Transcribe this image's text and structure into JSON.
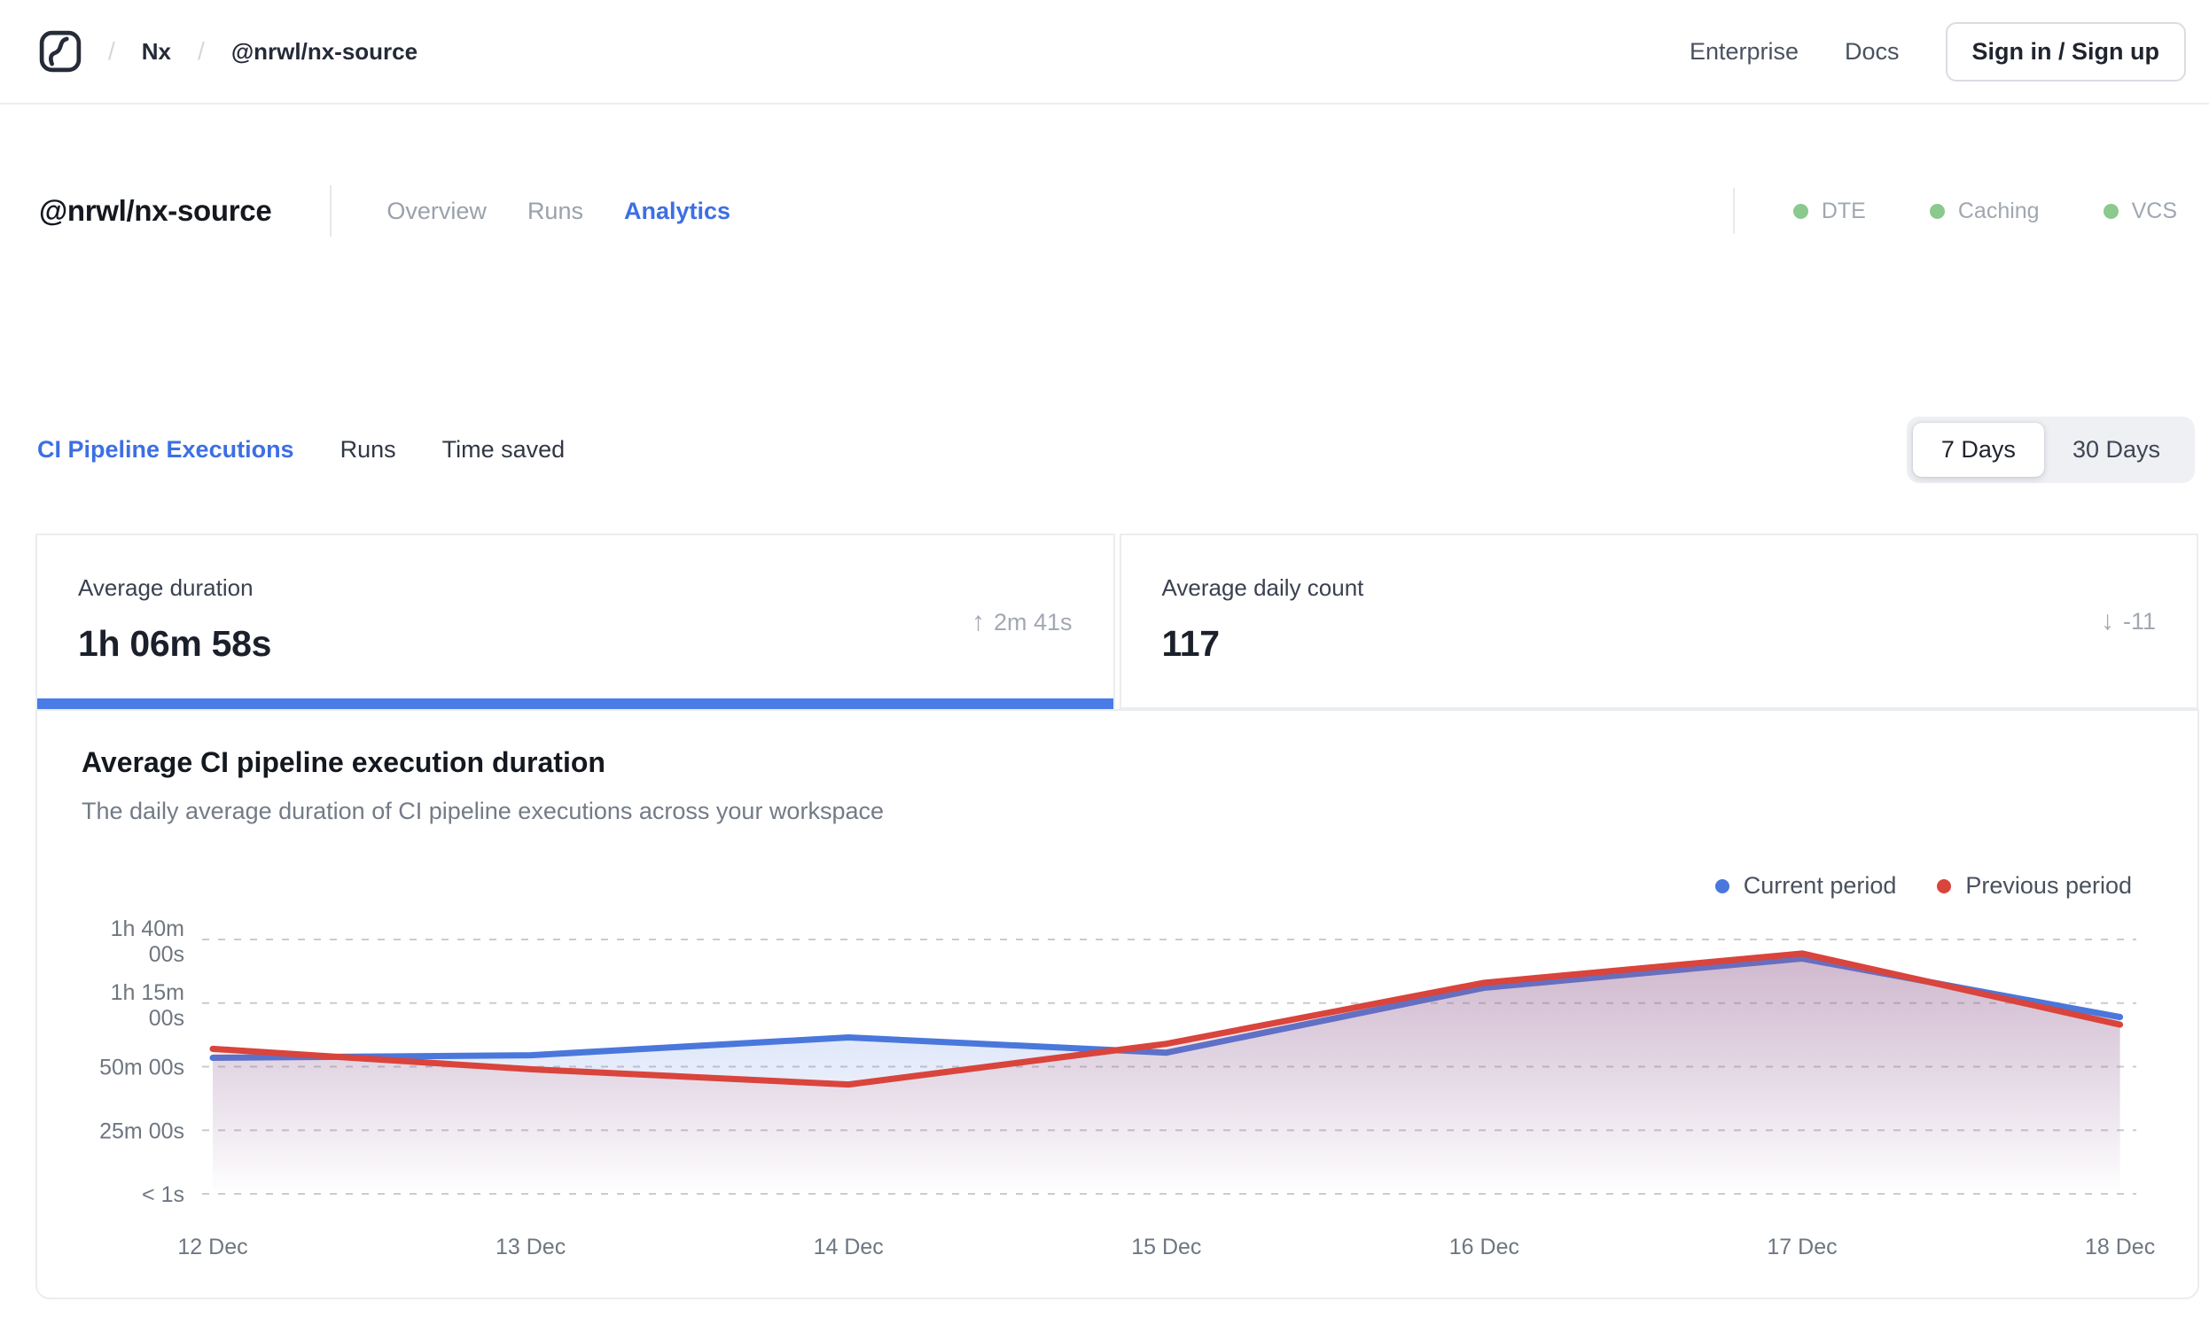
{
  "header": {
    "logo": "nx-cloud-logo",
    "breadcrumb": {
      "separator": "/",
      "items": [
        "Nx",
        "@nrwl/nx-source"
      ]
    },
    "links": [
      {
        "label": "Enterprise"
      },
      {
        "label": "Docs"
      }
    ],
    "signin_label": "Sign in / Sign up"
  },
  "titlebar": {
    "title": "@nrwl/nx-source",
    "tabs": [
      {
        "label": "Overview",
        "active": false
      },
      {
        "label": "Runs",
        "active": false
      },
      {
        "label": "Analytics",
        "active": true
      }
    ],
    "badges": [
      {
        "label": "DTE"
      },
      {
        "label": "Caching"
      },
      {
        "label": "VCS"
      }
    ],
    "badge_dot_color": "#8bc98f"
  },
  "subtabs": {
    "items": [
      {
        "label": "CI Pipeline Executions",
        "active": true
      },
      {
        "label": "Runs",
        "active": false
      },
      {
        "label": "Time saved",
        "active": false
      }
    ]
  },
  "range_toggle": {
    "options": [
      {
        "label": "7 Days",
        "active": true
      },
      {
        "label": "30 Days",
        "active": false
      }
    ]
  },
  "stats": [
    {
      "label": "Average duration",
      "value": "1h 06m 58s",
      "arrow_glyph": "↑",
      "delta": "2m 41s",
      "selected": true
    },
    {
      "label": "Average daily count",
      "value": "117",
      "arrow_glyph": "↓",
      "delta": "-11",
      "selected": false
    }
  ],
  "accent_colors": {
    "active_blue": "#3d6fe4",
    "selected_bar": "#4a7ce8"
  },
  "chart_data": {
    "type": "area",
    "title": "Average CI pipeline execution duration",
    "subtitle": "The daily average duration of CI pipeline executions across your workspace",
    "x": [
      "12 Dec",
      "13 Dec",
      "14 Dec",
      "15 Dec",
      "16 Dec",
      "17 Dec",
      "18 Dec"
    ],
    "y_ticks": [
      {
        "lines": [
          "1h 40m",
          "00s"
        ],
        "minutes": 100
      },
      {
        "lines": [
          "1h 15m",
          "00s"
        ],
        "minutes": 75
      },
      {
        "lines": [
          "50m 00s"
        ],
        "minutes": 50
      },
      {
        "lines": [
          "25m 00s"
        ],
        "minutes": 25
      },
      {
        "lines": [
          "< 1s"
        ],
        "minutes": 0
      }
    ],
    "ylim_minutes": [
      0,
      100
    ],
    "grid": "dashed",
    "legend_position": "top-right",
    "series": [
      {
        "name": "Current period",
        "color": "#4a77dc",
        "fill_top": "rgba(86,126,220,0.30)",
        "fill_bottom": "rgba(86,126,220,0)",
        "values_minutes": [
          53.5,
          54.5,
          61.5,
          55.5,
          81,
          92.5,
          69.5
        ]
      },
      {
        "name": "Previous period",
        "color": "#d9443c",
        "fill_top": "rgba(211,77,82,0.26)",
        "fill_bottom": "rgba(211,77,82,0)",
        "values_minutes": [
          57,
          49,
          43,
          59,
          83,
          94.5,
          66.5
        ]
      }
    ]
  }
}
